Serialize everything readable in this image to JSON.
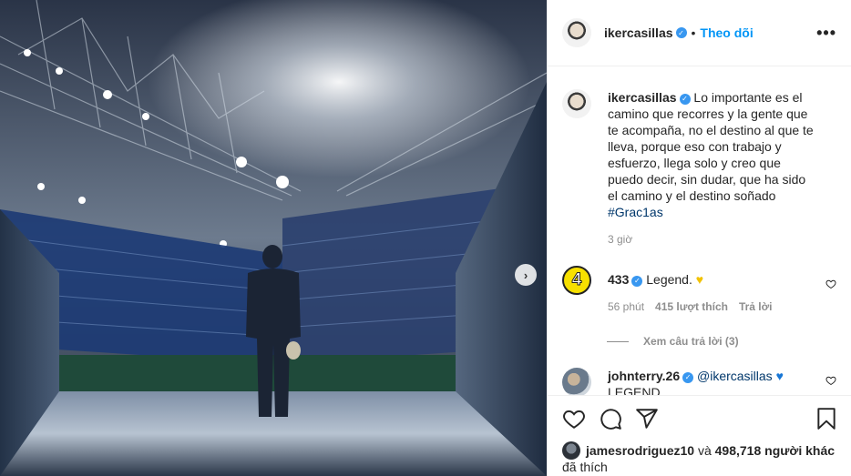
{
  "post": {
    "author": "ikercasillas",
    "separator": "•",
    "follow_label": "Theo dõi",
    "more_label": "•••",
    "next_arrow": "›"
  },
  "caption": {
    "author": "ikercasillas",
    "text": "Lo importante es el camino que recorres y la gente que te acompaña, no el destino al que te lleva, porque eso con trabajo y esfuerzo, llega solo y creo que puedo decir, sin dudar, que ha sido el camino y el destino soñado ",
    "hashtag": "#Grac1as",
    "time": "3 giờ"
  },
  "comments": [
    {
      "author": "433",
      "avatar_text": "4",
      "text": "Legend. ",
      "emoji": "♥",
      "emoji_color": "#f2c200",
      "time": "56 phút",
      "likes": "415 lượt thích",
      "reply_label": "Trả lời",
      "view_replies": "Xem câu trả lời (3)"
    },
    {
      "author": "johnterry.26",
      "mention": "@ikercasillas",
      "emoji": "♥",
      "emoji_color": "#1877d6",
      "text": "LEGEND"
    }
  ],
  "likes": {
    "user": "jamesrodriguez10",
    "joiner": " và ",
    "count": "498,718 người khác",
    "tail": "đã thích"
  },
  "icons": {
    "like": "heart-icon",
    "comment": "comment-icon",
    "share": "share-icon",
    "save": "bookmark-icon",
    "options": "more-options-icon"
  },
  "colors": {
    "accent": "#0095f6",
    "verified": "#3897f0",
    "link": "#00376b",
    "muted": "#8e8e8e"
  }
}
